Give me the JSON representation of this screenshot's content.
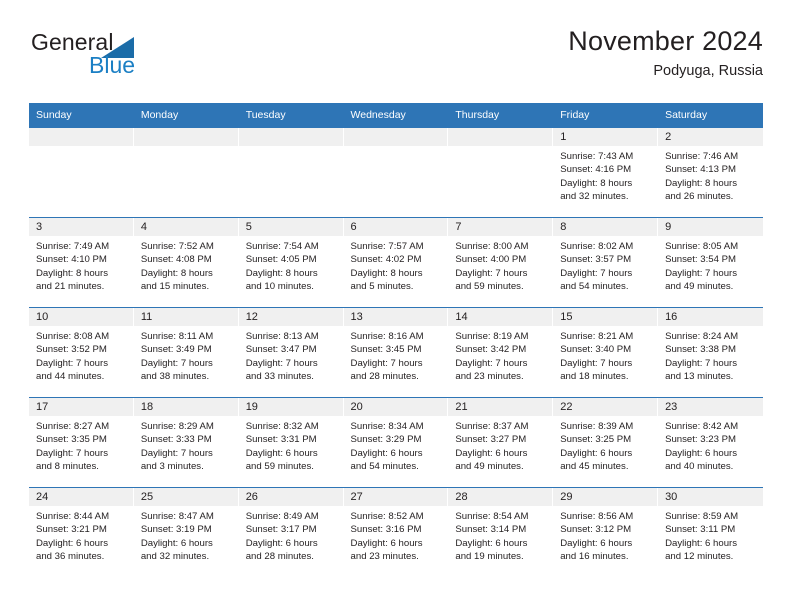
{
  "brand": {
    "name_part1": "General",
    "name_part2": "Blue",
    "triangle_color": "#1b6ca8",
    "blue_text_color": "#1b7fc4"
  },
  "header": {
    "title": "November 2024",
    "location": "Podyuga, Russia",
    "accent_color": "#2e75b6",
    "band_color": "#f0f0f0"
  },
  "weekday_headers": [
    "Sunday",
    "Monday",
    "Tuesday",
    "Wednesday",
    "Thursday",
    "Friday",
    "Saturday"
  ],
  "weeks": [
    [
      {
        "day": "",
        "empty": true
      },
      {
        "day": "",
        "empty": true
      },
      {
        "day": "",
        "empty": true
      },
      {
        "day": "",
        "empty": true
      },
      {
        "day": "",
        "empty": true
      },
      {
        "day": "1",
        "sunrise": "Sunrise: 7:43 AM",
        "sunset": "Sunset: 4:16 PM",
        "daylight_line1": "Daylight: 8 hours",
        "daylight_line2": "and 32 minutes."
      },
      {
        "day": "2",
        "sunrise": "Sunrise: 7:46 AM",
        "sunset": "Sunset: 4:13 PM",
        "daylight_line1": "Daylight: 8 hours",
        "daylight_line2": "and 26 minutes."
      }
    ],
    [
      {
        "day": "3",
        "sunrise": "Sunrise: 7:49 AM",
        "sunset": "Sunset: 4:10 PM",
        "daylight_line1": "Daylight: 8 hours",
        "daylight_line2": "and 21 minutes."
      },
      {
        "day": "4",
        "sunrise": "Sunrise: 7:52 AM",
        "sunset": "Sunset: 4:08 PM",
        "daylight_line1": "Daylight: 8 hours",
        "daylight_line2": "and 15 minutes."
      },
      {
        "day": "5",
        "sunrise": "Sunrise: 7:54 AM",
        "sunset": "Sunset: 4:05 PM",
        "daylight_line1": "Daylight: 8 hours",
        "daylight_line2": "and 10 minutes."
      },
      {
        "day": "6",
        "sunrise": "Sunrise: 7:57 AM",
        "sunset": "Sunset: 4:02 PM",
        "daylight_line1": "Daylight: 8 hours",
        "daylight_line2": "and 5 minutes."
      },
      {
        "day": "7",
        "sunrise": "Sunrise: 8:00 AM",
        "sunset": "Sunset: 4:00 PM",
        "daylight_line1": "Daylight: 7 hours",
        "daylight_line2": "and 59 minutes."
      },
      {
        "day": "8",
        "sunrise": "Sunrise: 8:02 AM",
        "sunset": "Sunset: 3:57 PM",
        "daylight_line1": "Daylight: 7 hours",
        "daylight_line2": "and 54 minutes."
      },
      {
        "day": "9",
        "sunrise": "Sunrise: 8:05 AM",
        "sunset": "Sunset: 3:54 PM",
        "daylight_line1": "Daylight: 7 hours",
        "daylight_line2": "and 49 minutes."
      }
    ],
    [
      {
        "day": "10",
        "sunrise": "Sunrise: 8:08 AM",
        "sunset": "Sunset: 3:52 PM",
        "daylight_line1": "Daylight: 7 hours",
        "daylight_line2": "and 44 minutes."
      },
      {
        "day": "11",
        "sunrise": "Sunrise: 8:11 AM",
        "sunset": "Sunset: 3:49 PM",
        "daylight_line1": "Daylight: 7 hours",
        "daylight_line2": "and 38 minutes."
      },
      {
        "day": "12",
        "sunrise": "Sunrise: 8:13 AM",
        "sunset": "Sunset: 3:47 PM",
        "daylight_line1": "Daylight: 7 hours",
        "daylight_line2": "and 33 minutes."
      },
      {
        "day": "13",
        "sunrise": "Sunrise: 8:16 AM",
        "sunset": "Sunset: 3:45 PM",
        "daylight_line1": "Daylight: 7 hours",
        "daylight_line2": "and 28 minutes."
      },
      {
        "day": "14",
        "sunrise": "Sunrise: 8:19 AM",
        "sunset": "Sunset: 3:42 PM",
        "daylight_line1": "Daylight: 7 hours",
        "daylight_line2": "and 23 minutes."
      },
      {
        "day": "15",
        "sunrise": "Sunrise: 8:21 AM",
        "sunset": "Sunset: 3:40 PM",
        "daylight_line1": "Daylight: 7 hours",
        "daylight_line2": "and 18 minutes."
      },
      {
        "day": "16",
        "sunrise": "Sunrise: 8:24 AM",
        "sunset": "Sunset: 3:38 PM",
        "daylight_line1": "Daylight: 7 hours",
        "daylight_line2": "and 13 minutes."
      }
    ],
    [
      {
        "day": "17",
        "sunrise": "Sunrise: 8:27 AM",
        "sunset": "Sunset: 3:35 PM",
        "daylight_line1": "Daylight: 7 hours",
        "daylight_line2": "and 8 minutes."
      },
      {
        "day": "18",
        "sunrise": "Sunrise: 8:29 AM",
        "sunset": "Sunset: 3:33 PM",
        "daylight_line1": "Daylight: 7 hours",
        "daylight_line2": "and 3 minutes."
      },
      {
        "day": "19",
        "sunrise": "Sunrise: 8:32 AM",
        "sunset": "Sunset: 3:31 PM",
        "daylight_line1": "Daylight: 6 hours",
        "daylight_line2": "and 59 minutes."
      },
      {
        "day": "20",
        "sunrise": "Sunrise: 8:34 AM",
        "sunset": "Sunset: 3:29 PM",
        "daylight_line1": "Daylight: 6 hours",
        "daylight_line2": "and 54 minutes."
      },
      {
        "day": "21",
        "sunrise": "Sunrise: 8:37 AM",
        "sunset": "Sunset: 3:27 PM",
        "daylight_line1": "Daylight: 6 hours",
        "daylight_line2": "and 49 minutes."
      },
      {
        "day": "22",
        "sunrise": "Sunrise: 8:39 AM",
        "sunset": "Sunset: 3:25 PM",
        "daylight_line1": "Daylight: 6 hours",
        "daylight_line2": "and 45 minutes."
      },
      {
        "day": "23",
        "sunrise": "Sunrise: 8:42 AM",
        "sunset": "Sunset: 3:23 PM",
        "daylight_line1": "Daylight: 6 hours",
        "daylight_line2": "and 40 minutes."
      }
    ],
    [
      {
        "day": "24",
        "sunrise": "Sunrise: 8:44 AM",
        "sunset": "Sunset: 3:21 PM",
        "daylight_line1": "Daylight: 6 hours",
        "daylight_line2": "and 36 minutes."
      },
      {
        "day": "25",
        "sunrise": "Sunrise: 8:47 AM",
        "sunset": "Sunset: 3:19 PM",
        "daylight_line1": "Daylight: 6 hours",
        "daylight_line2": "and 32 minutes."
      },
      {
        "day": "26",
        "sunrise": "Sunrise: 8:49 AM",
        "sunset": "Sunset: 3:17 PM",
        "daylight_line1": "Daylight: 6 hours",
        "daylight_line2": "and 28 minutes."
      },
      {
        "day": "27",
        "sunrise": "Sunrise: 8:52 AM",
        "sunset": "Sunset: 3:16 PM",
        "daylight_line1": "Daylight: 6 hours",
        "daylight_line2": "and 23 minutes."
      },
      {
        "day": "28",
        "sunrise": "Sunrise: 8:54 AM",
        "sunset": "Sunset: 3:14 PM",
        "daylight_line1": "Daylight: 6 hours",
        "daylight_line2": "and 19 minutes."
      },
      {
        "day": "29",
        "sunrise": "Sunrise: 8:56 AM",
        "sunset": "Sunset: 3:12 PM",
        "daylight_line1": "Daylight: 6 hours",
        "daylight_line2": "and 16 minutes."
      },
      {
        "day": "30",
        "sunrise": "Sunrise: 8:59 AM",
        "sunset": "Sunset: 3:11 PM",
        "daylight_line1": "Daylight: 6 hours",
        "daylight_line2": "and 12 minutes."
      }
    ]
  ]
}
